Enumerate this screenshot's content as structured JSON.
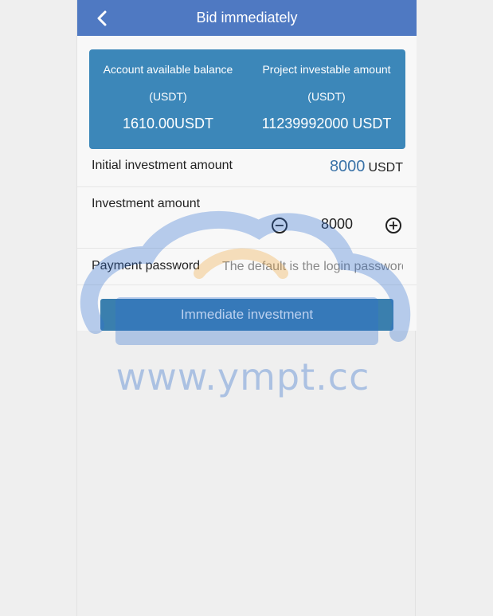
{
  "header": {
    "title": "Bid immediately",
    "back_icon": "chevron-left-icon"
  },
  "summary": {
    "balance_label": "Account available balance",
    "balance_unit": "(USDT)",
    "balance_value": "1610.00USDT",
    "project_label": "Project investable amount",
    "project_unit": "(USDT)",
    "project_value": "11239992000 USDT"
  },
  "form": {
    "initial_label": "Initial investment amount",
    "initial_value": "8000",
    "initial_unit": "USDT",
    "investment_label": "Investment amount",
    "investment_value": "8000",
    "minus_symbol": "−",
    "plus_symbol": "+",
    "password_label": "Payment password",
    "password_placeholder": "The default is the login password"
  },
  "actions": {
    "submit_label": "Immediate investment"
  },
  "watermark": {
    "text": "www.ympt.cc"
  },
  "colors": {
    "header_bg": "#4f79c2",
    "card_bg": "#3c87b9",
    "button_bg": "#3a7fae",
    "accent_value": "#3b73a8"
  }
}
